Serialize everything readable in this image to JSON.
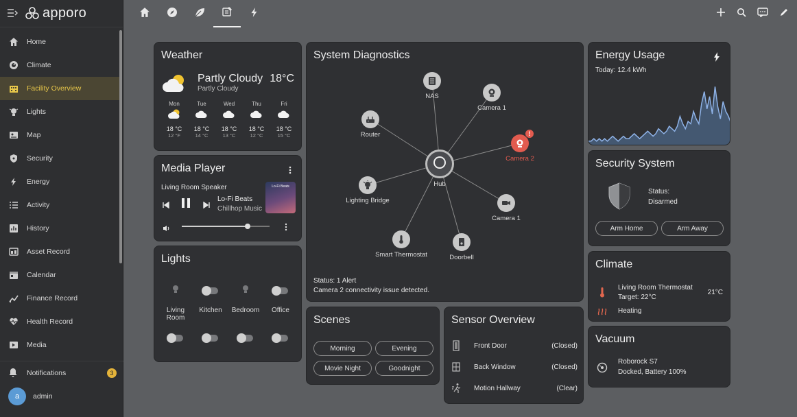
{
  "app": {
    "name": "apporo"
  },
  "sidebar": {
    "items": [
      {
        "label": "Home",
        "icon": "home-icon"
      },
      {
        "label": "Climate",
        "icon": "thermostat-icon"
      },
      {
        "label": "Facility Overview",
        "icon": "building-icon"
      },
      {
        "label": "Lights",
        "icon": "lightbulb-icon"
      },
      {
        "label": "Map",
        "icon": "map-icon"
      },
      {
        "label": "Security",
        "icon": "shield-icon"
      },
      {
        "label": "Energy",
        "icon": "lightning-icon"
      },
      {
        "label": "Activity",
        "icon": "list-icon"
      },
      {
        "label": "History",
        "icon": "chart-icon"
      },
      {
        "label": "Asset Record",
        "icon": "asset-icon"
      },
      {
        "label": "Calendar",
        "icon": "calendar-icon"
      },
      {
        "label": "Finance Record",
        "icon": "finance-icon"
      },
      {
        "label": "Health Record",
        "icon": "heart-icon"
      },
      {
        "label": "Media",
        "icon": "play-icon"
      }
    ],
    "active_index": 2,
    "notifications": {
      "label": "Notifications",
      "count": "3"
    },
    "user": {
      "initial": "a",
      "name": "admin"
    }
  },
  "topbar": {
    "tabs": [
      "home-icon",
      "compass-icon",
      "leaf-icon",
      "facility-icon",
      "lightning-icon"
    ],
    "active_tab": 3
  },
  "weather": {
    "title": "Weather",
    "condition": "Partly Cloudy",
    "sub": "Partly Cloudy",
    "temp": "18°C",
    "forecast": [
      {
        "day": "Mon",
        "hi": "18 °C",
        "lo": "12 °F",
        "icon": "sun-cloud-icon"
      },
      {
        "day": "Tue",
        "hi": "18 °C",
        "lo": "14 °C",
        "icon": "cloud-icon"
      },
      {
        "day": "Wed",
        "hi": "18 °C",
        "lo": "13 °C",
        "icon": "cloud-icon"
      },
      {
        "day": "Thu",
        "hi": "18 °C",
        "lo": "12 °C",
        "icon": "cloud-icon"
      },
      {
        "day": "Fri",
        "hi": "18 °C",
        "lo": "15 °C",
        "icon": "cloud-icon"
      }
    ]
  },
  "media": {
    "title": "Media Player",
    "device": "Living Room Speaker",
    "track": "Lo-Fi Beats",
    "artist": "Chillhop Music",
    "album_text": "Lo-Fi Beats",
    "volume": 0.75
  },
  "lights": {
    "title": "Lights",
    "rooms": [
      {
        "label": "Living Room",
        "on": true
      },
      {
        "label": "Kitchen",
        "on": false
      },
      {
        "label": "Bedroom",
        "on": true
      },
      {
        "label": "Office",
        "on": false
      }
    ]
  },
  "diagnostics": {
    "title": "System Diagnostics",
    "hub": "Hub",
    "nodes": [
      {
        "label": "NAS",
        "icon": "server-icon"
      },
      {
        "label": "Camera 1",
        "icon": "webcam-icon"
      },
      {
        "label": "Router",
        "icon": "router-icon"
      },
      {
        "label": "Camera 2",
        "icon": "webcam-icon",
        "alert": true
      },
      {
        "label": "Lighting Bridge",
        "icon": "bulb-icon"
      },
      {
        "label": "Camera 1",
        "icon": "video-camera-icon"
      },
      {
        "label": "Smart Thermostat",
        "icon": "thermometer-icon"
      },
      {
        "label": "Doorbell",
        "icon": "doorbell-icon"
      }
    ],
    "status": "Status: 1 Alert",
    "message": "Camera 2 connectivity issue detected.",
    "alert_color": "#e25b4f"
  },
  "scenes": {
    "title": "Scenes",
    "buttons": [
      "Morning",
      "Evening",
      "Movie Night",
      "Goodnight"
    ]
  },
  "sensors": {
    "title": "Sensor Overview",
    "rows": [
      {
        "label": "Front Door",
        "value": "(Closed)",
        "icon": "door-icon"
      },
      {
        "label": "Back Window",
        "value": "(Closed)",
        "icon": "window-icon"
      },
      {
        "label": "Motion Hallway",
        "value": "(Clear)",
        "icon": "motion-icon"
      }
    ]
  },
  "energy": {
    "title": "Energy Usage",
    "today": "Today: 12.4 kWh",
    "series": [
      2,
      2,
      3,
      2,
      3,
      2,
      3,
      2,
      3,
      4,
      3,
      2,
      3,
      4,
      3,
      3,
      4,
      5,
      4,
      3,
      4,
      5,
      6,
      5,
      4,
      5,
      7,
      6,
      5,
      6,
      8,
      7,
      6,
      8,
      12,
      9,
      7,
      10,
      9,
      14,
      11,
      9,
      17,
      22,
      15,
      20,
      13,
      24,
      16,
      11,
      18,
      14,
      12,
      9
    ]
  },
  "security": {
    "title": "Security System",
    "status_label": "Status:",
    "status_value": "Disarmed",
    "arm_home": "Arm Home",
    "arm_away": "Arm Away"
  },
  "climate": {
    "title": "Climate",
    "device": "Living Room Thermostat",
    "target": "Target: 22°C",
    "current": "21°C",
    "mode": "Heating",
    "accent": "#e0664e"
  },
  "vacuum": {
    "title": "Vacuum",
    "name": "Roborock S7",
    "status": "Docked, Battery 100%"
  }
}
